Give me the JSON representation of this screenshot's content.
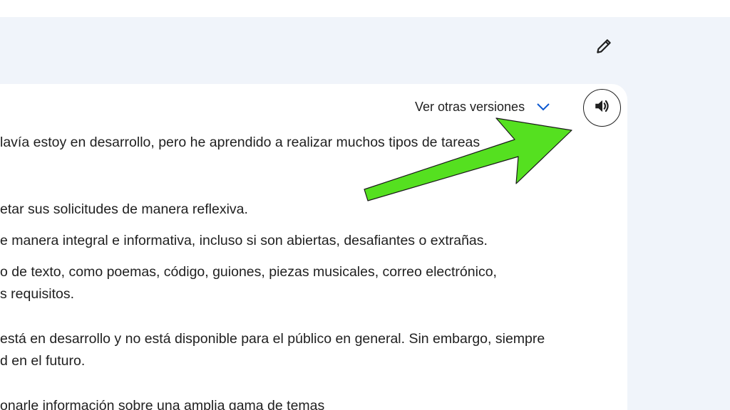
{
  "response": {
    "versions_label": "Ver otras versiones",
    "lines": [
      "lavía estoy en desarrollo, pero he aprendido a realizar muchos tipos de tareas",
      "etar sus solicitudes de manera reflexiva.",
      "e manera integral e informativa, incluso si son abiertas, desafiantes o extrañas.",
      "o de texto, como poemas, código, guiones, piezas musicales, correo electrónico,",
      "s requisitos.",
      "está en desarrollo y no está disponible para el público en general. Sin embargo, siempre",
      "d en el futuro.",
      "onarle información sobre una amplia gama de temas"
    ]
  },
  "icons": {
    "edit": "pencil-icon",
    "versions_toggle": "chevron-down-icon",
    "listen": "speaker-icon"
  },
  "colors": {
    "pane_background": "#f0f4fa",
    "card_background": "#ffffff",
    "text": "#1f1f1f",
    "chevron": "#0b57d0",
    "annotation_arrow": "#55e020"
  }
}
